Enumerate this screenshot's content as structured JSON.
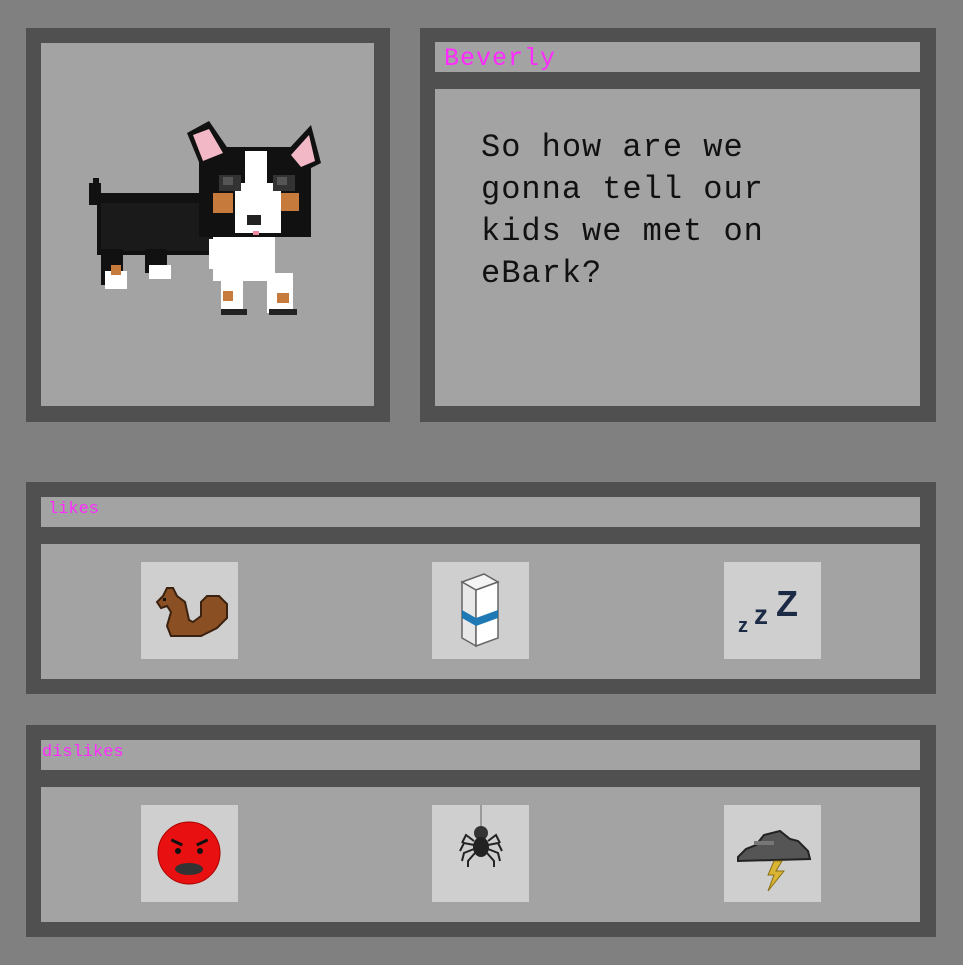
{
  "profile": {
    "name": "Beverly",
    "message": "So how are we gonna tell our kids we met on eBark?",
    "photo_icon": "chihuahua-pixel-art"
  },
  "likes": {
    "label": "likes",
    "items": [
      {
        "icon": "squirrel-icon"
      },
      {
        "icon": "milk-carton-icon"
      },
      {
        "icon": "sleep-zzz-icon"
      }
    ]
  },
  "dislikes": {
    "label": "dislikes",
    "items": [
      {
        "icon": "angry-face-icon"
      },
      {
        "icon": "spider-icon"
      },
      {
        "icon": "thunderstorm-cloud-icon"
      }
    ]
  },
  "colors": {
    "background": "#808080",
    "frame": "#505050",
    "panel": "#a3a3a3",
    "tile": "#cfcfcf",
    "accent_text": "#ff2bff"
  }
}
